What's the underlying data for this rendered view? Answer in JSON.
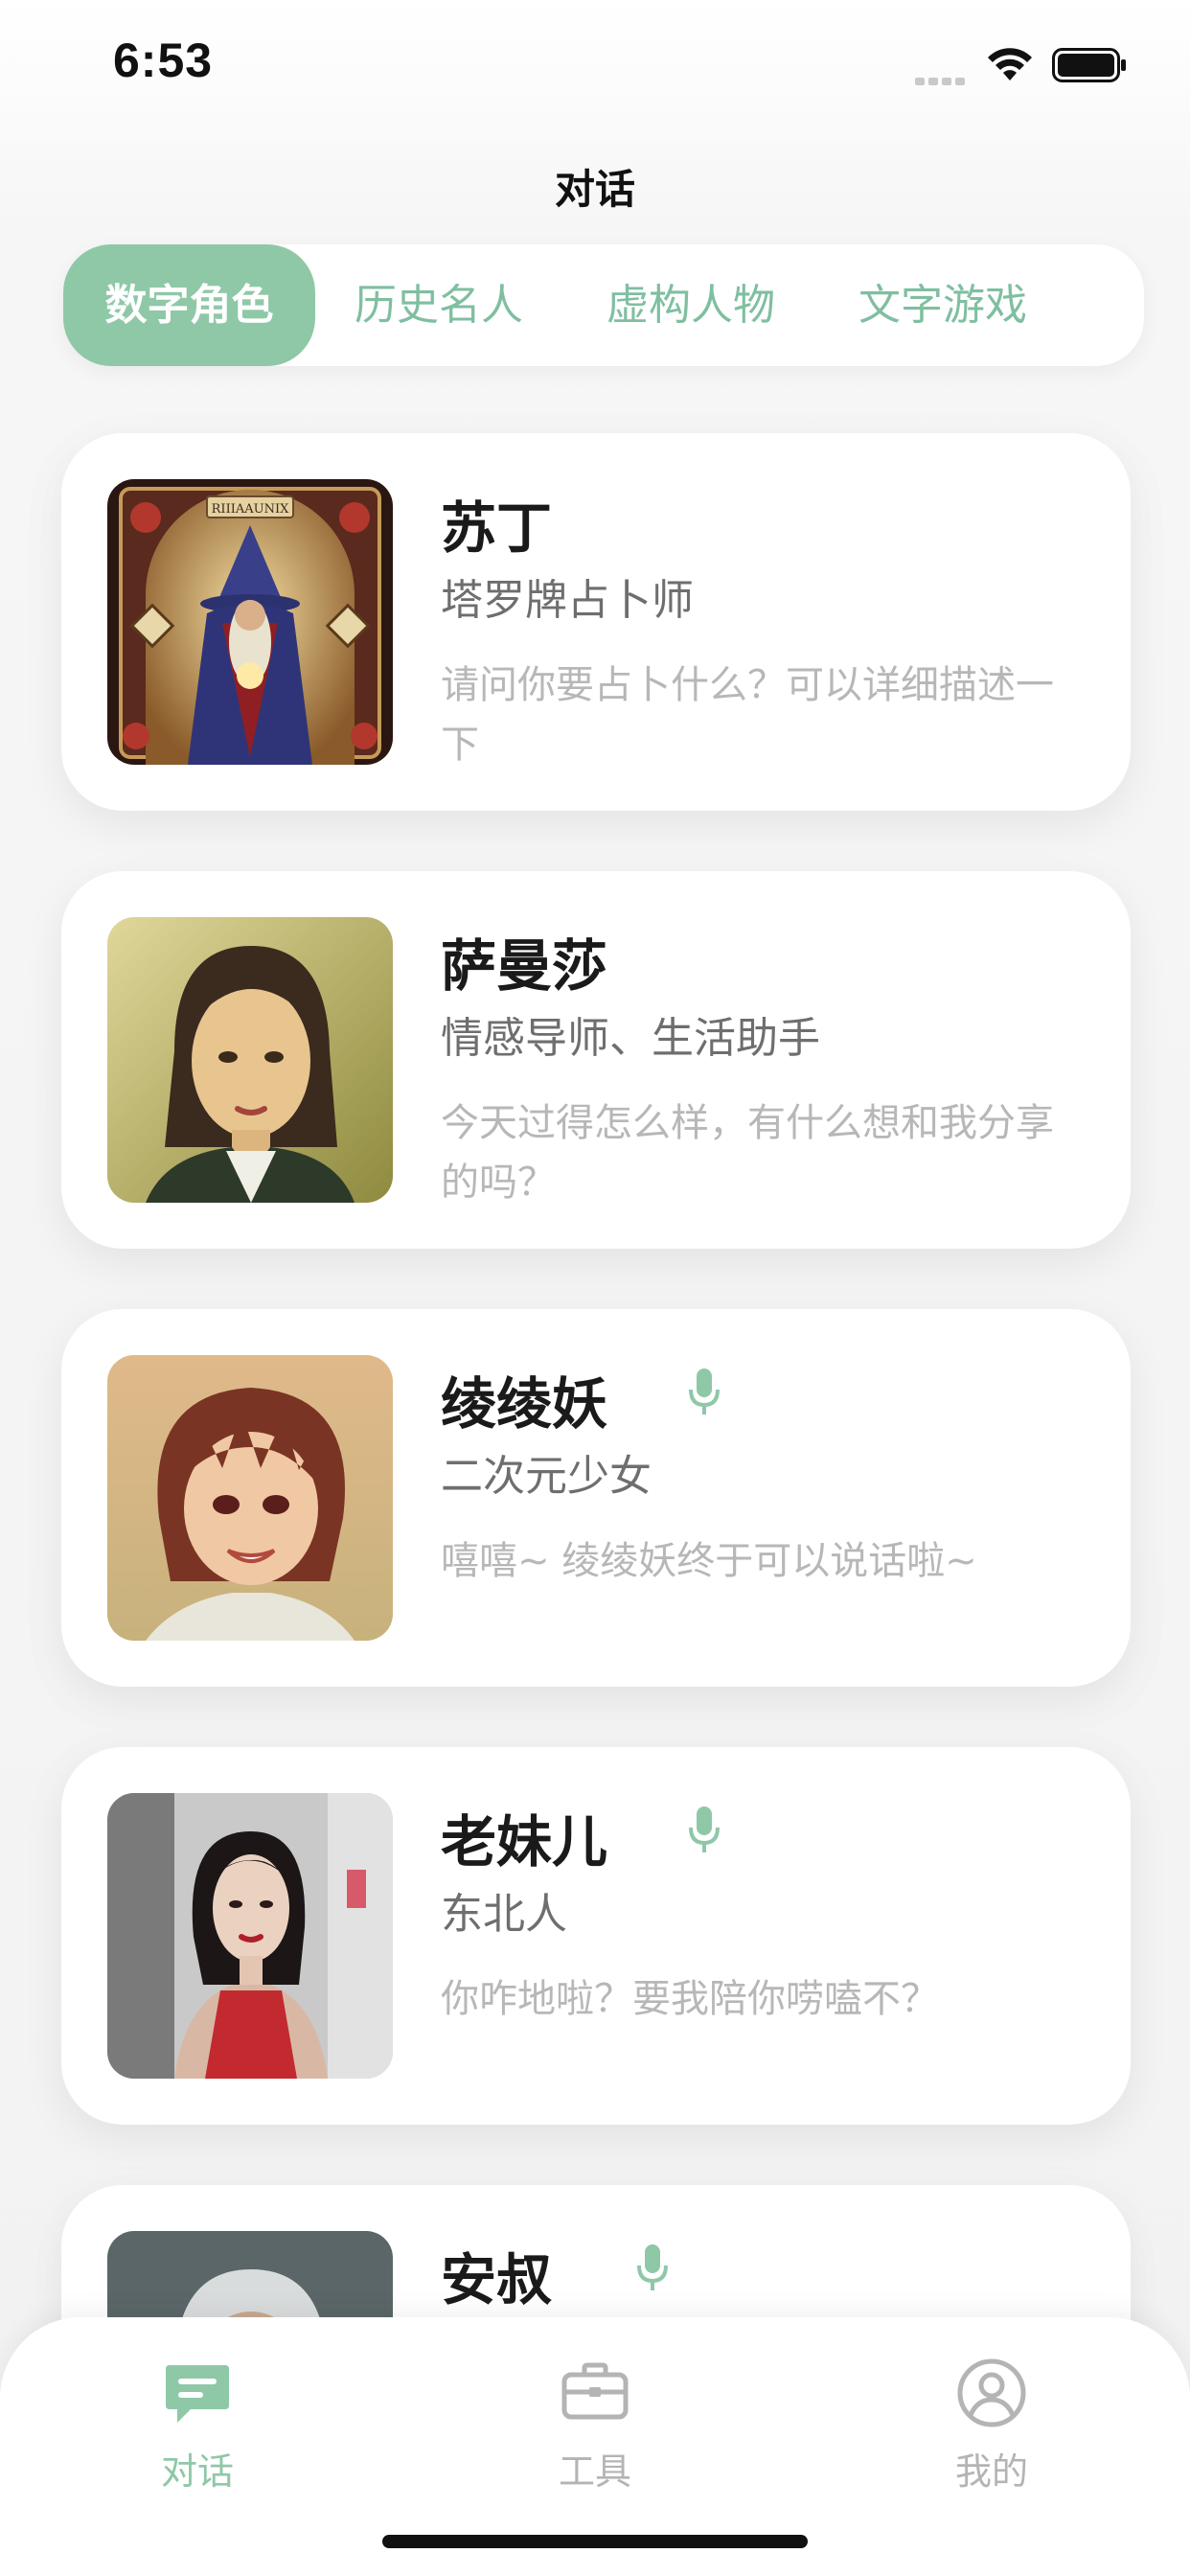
{
  "status_bar": {
    "time": "6:53"
  },
  "header": {
    "title": "对话"
  },
  "tabs": [
    {
      "label": "数字角色",
      "active": true
    },
    {
      "label": "历史名人",
      "active": false
    },
    {
      "label": "虚构人物",
      "active": false
    },
    {
      "label": "文字游戏",
      "active": false
    }
  ],
  "characters": [
    {
      "name": "苏丁",
      "subtitle": "塔罗牌占卜师",
      "message": "请问你要占卜什么？可以详细描述一下",
      "voice": false,
      "avatar_card_text": "RIIIAAUNIX"
    },
    {
      "name": "萨曼莎",
      "subtitle": "情感导师、生活助手",
      "message": "今天过得怎么样，有什么想和我分享的吗？",
      "voice": false
    },
    {
      "name": "绫绫妖",
      "subtitle": "二次元少女",
      "message": "嘻嘻~ 绫绫妖终于可以说话啦~",
      "voice": true
    },
    {
      "name": "老妹儿",
      "subtitle": "东北人",
      "message": "你咋地啦？要我陪你唠嗑不？",
      "voice": true
    },
    {
      "name": "安叔",
      "subtitle": "",
      "message": "",
      "voice": true
    }
  ],
  "tab_bar": {
    "items": [
      {
        "label": "对话",
        "icon": "chat-bubble-icon",
        "active": true
      },
      {
        "label": "工具",
        "icon": "toolbox-icon",
        "active": false
      },
      {
        "label": "我的",
        "icon": "user-icon",
        "active": false
      }
    ]
  },
  "colors": {
    "accent": "#8fc8a7",
    "inactive": "#b4b4b4",
    "background": "#f4f4f4"
  }
}
